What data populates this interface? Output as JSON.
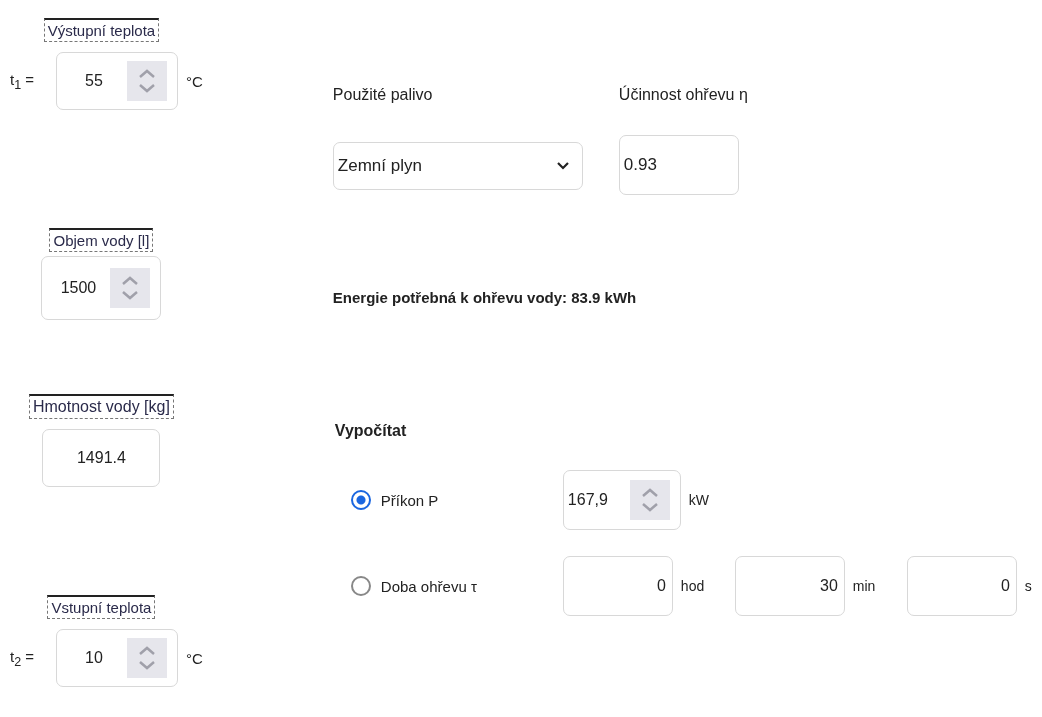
{
  "outlet": {
    "label": "Výstupní teplota",
    "symbol": "t$_{1}$ =",
    "value": "55",
    "unit": "°C"
  },
  "volume": {
    "label": "Objem vody [l]",
    "value": "1500"
  },
  "mass": {
    "label": "Hmotnost vody [kg]",
    "value": "1491.4"
  },
  "inlet": {
    "label": "Vstupní teplota",
    "symbol": "t$_{2}$ =",
    "value": "10",
    "unit": "°C"
  },
  "fuel": {
    "label": "Použité palivo",
    "value": "Zemní plyn"
  },
  "efficiency": {
    "label": "Účinnost ohřevu η",
    "value": "0.93"
  },
  "energy": "Energie potřebná k ohřevu vody: 83.9 kWh",
  "calculate": {
    "title": "Vypočítat",
    "options": [
      {
        "kind": "power",
        "label": "Příkon P",
        "selected": true,
        "value": "167,9",
        "unit": "kW"
      },
      {
        "kind": "time",
        "label": "Doba ohřevu τ",
        "selected": false,
        "fields": [
          {
            "value": "0",
            "unit": "hod"
          },
          {
            "value": "30",
            "unit": "min"
          },
          {
            "value": "0",
            "unit": "s"
          }
        ]
      }
    ]
  }
}
